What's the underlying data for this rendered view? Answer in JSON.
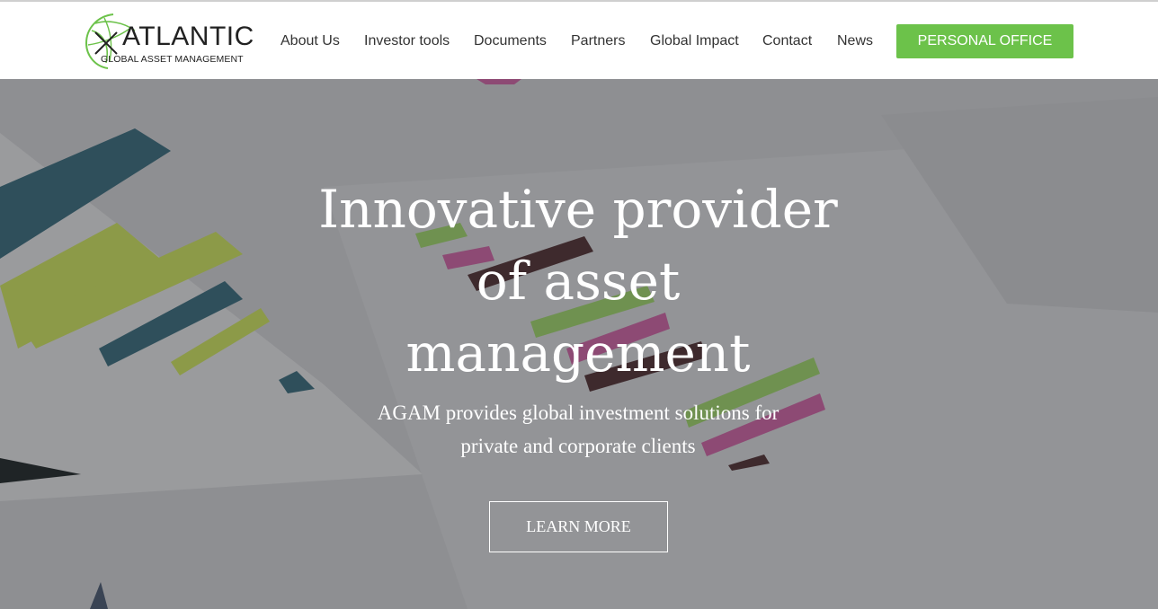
{
  "header": {
    "logo": {
      "title": "ATLANTIC",
      "subtitle": "GLOBAL ASSET MANAGEMENT"
    },
    "nav": [
      {
        "label": "About Us"
      },
      {
        "label": "Investor tools"
      },
      {
        "label": "Documents"
      },
      {
        "label": "Partners"
      },
      {
        "label": "Global Impact"
      },
      {
        "label": "Contact"
      },
      {
        "label": "News"
      }
    ],
    "cta_label": "PERSONAL OFFICE"
  },
  "hero": {
    "title_lines": [
      "Innovative provider",
      "of asset",
      "management"
    ],
    "subtitle_lines": [
      "AGAM provides global investment solutions for",
      "private and corporate clients"
    ],
    "button_label": "LEARN MORE"
  },
  "colors": {
    "accent": "#6cc24a",
    "overlay": "#8f9093"
  }
}
